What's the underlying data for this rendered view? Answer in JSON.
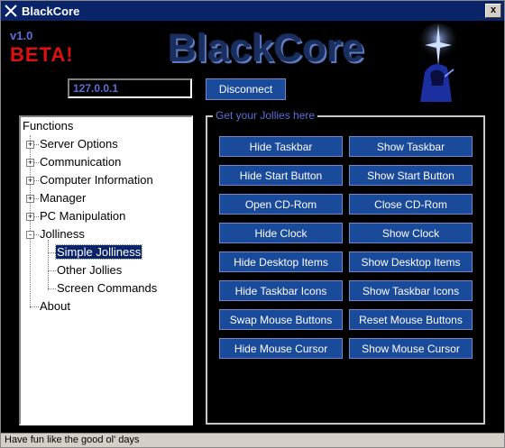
{
  "window": {
    "title": "BlackCore",
    "close_label": "x"
  },
  "header": {
    "version": "v1.0",
    "beta": "BETA!",
    "logo": "BlackCore"
  },
  "connection": {
    "ip_value": "127.0.0.1",
    "disconnect_label": "Disconnect"
  },
  "tree": {
    "root": "Functions",
    "items": [
      {
        "label": "Server Options",
        "expander": "+"
      },
      {
        "label": "Communication",
        "expander": "+"
      },
      {
        "label": "Computer Information",
        "expander": "+"
      },
      {
        "label": "Manager",
        "expander": "+"
      },
      {
        "label": "PC Manipulation",
        "expander": "+"
      },
      {
        "label": "Jolliness",
        "expander": "-"
      }
    ],
    "children": [
      "Simple Jolliness",
      "Other Jollies",
      "Screen Commands"
    ],
    "about": "About"
  },
  "jollies": {
    "legend": "Get your Jollies here",
    "buttons": [
      [
        "Hide Taskbar",
        "Show Taskbar"
      ],
      [
        "Hide Start Button",
        "Show Start Button"
      ],
      [
        "Open CD-Rom",
        "Close CD-Rom"
      ],
      [
        "Hide Clock",
        "Show Clock"
      ],
      [
        "Hide Desktop Items",
        "Show Desktop Items"
      ],
      [
        "Hide Taskbar Icons",
        "Show Taskbar Icons"
      ],
      [
        "Swap Mouse Buttons",
        "Reset Mouse Buttons"
      ],
      [
        "Hide Mouse Cursor",
        "Show Mouse Cursor"
      ]
    ]
  },
  "status": {
    "text": "Have fun like the good ol' days"
  },
  "colors": {
    "accent": "#1a4a9a",
    "title_bar": "#0a246a",
    "beta": "#e01010",
    "label_blue": "#5b6fd6"
  }
}
